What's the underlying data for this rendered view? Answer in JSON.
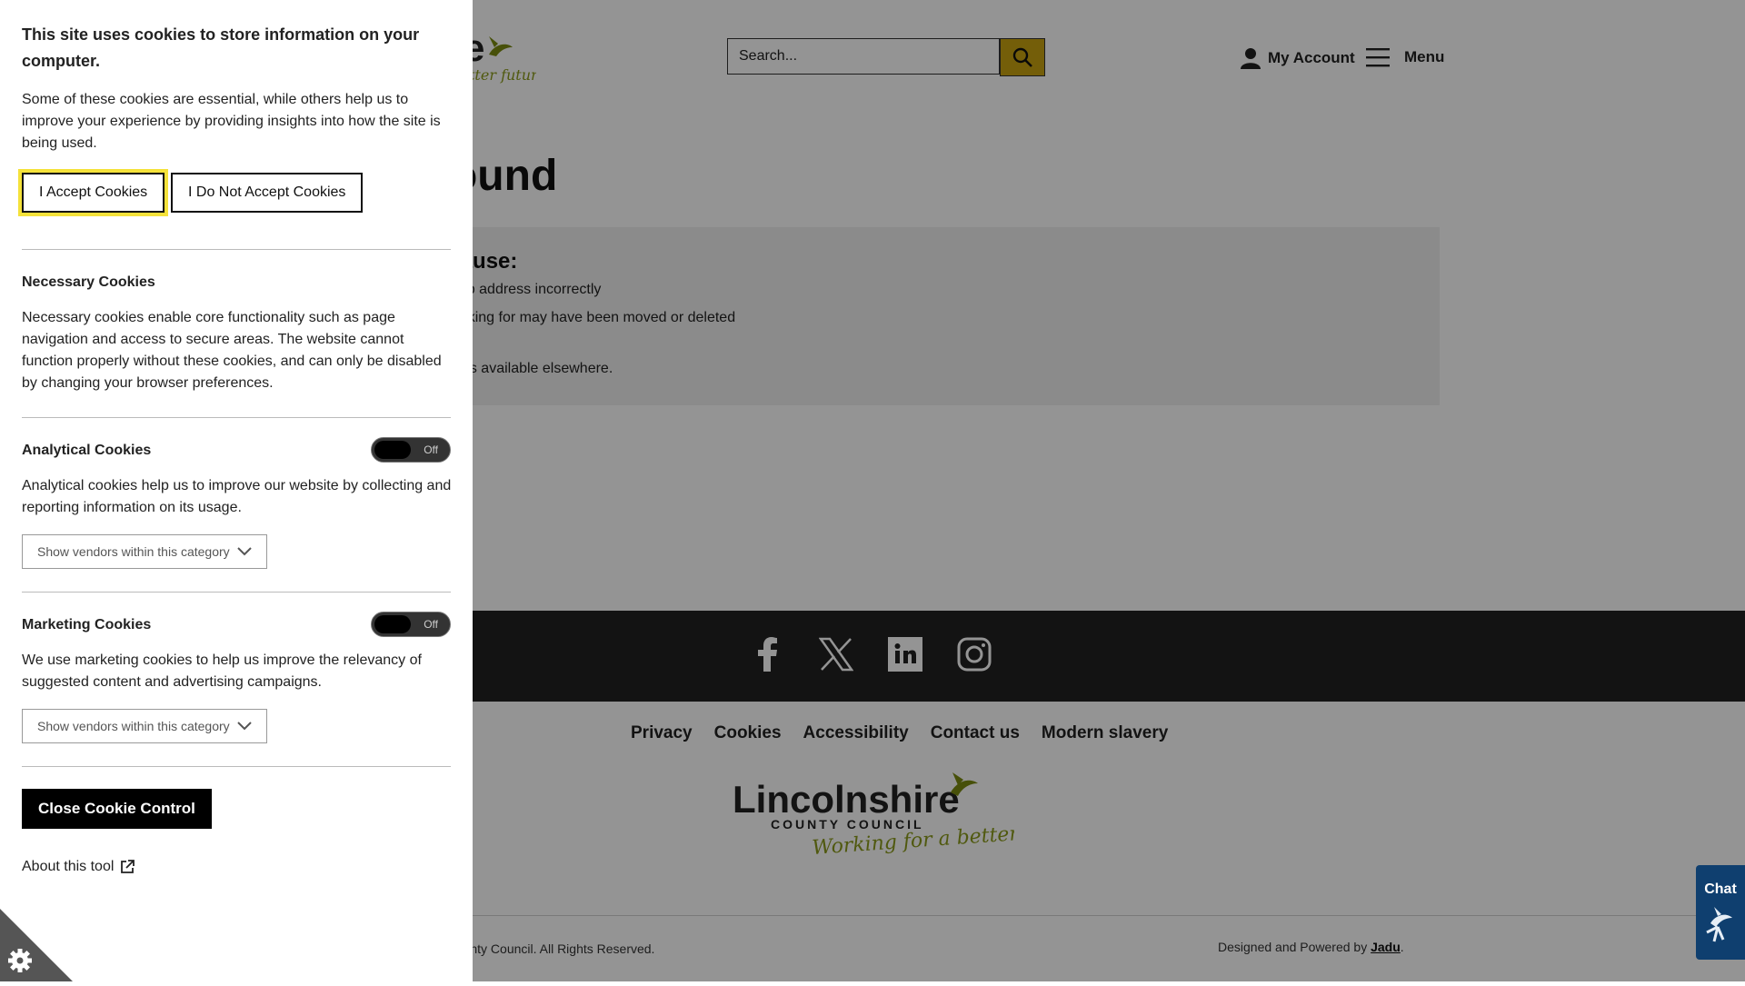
{
  "header": {
    "search_placeholder": "Search...",
    "account_label": "My Account",
    "menu_label": "Menu"
  },
  "main": {
    "title_visible": "found",
    "reasons_heading_visible": "ecause:",
    "reason_1_visible": "e web address incorrectly",
    "reason_2_visible": "e looking for may have been moved or deleted",
    "reason_3_visible": "e if it's available elsewhere."
  },
  "social": [
    "facebook-icon",
    "x-icon",
    "linkedin-icon",
    "instagram-icon"
  ],
  "footer": {
    "links": [
      "Privacy",
      "Cookies",
      "Accessibility",
      "Contact us",
      "Modern slavery"
    ],
    "logo_name": "Lincolnshire",
    "logo_sub": "COUNTY COUNCIL",
    "logo_tagline": "Working for a better future",
    "copyright_visible": "e County Council. All Rights Reserved.",
    "powered_prefix": "Designed and Powered by ",
    "powered_link": "Jadu",
    "powered_suffix": "."
  },
  "chat": {
    "label": "Chat"
  },
  "cookie_panel": {
    "heading": "This site uses cookies to store information on your computer.",
    "intro": "Some of these cookies are essential, while others help us to improve your experience by providing insights into how the site is being used.",
    "accept_label": "I Accept Cookies",
    "decline_label": "I Do Not Accept Cookies",
    "necessary_title": "Necessary Cookies",
    "necessary_text": "Necessary cookies enable core functionality such as page navigation and access to secure areas. The website cannot function properly without these cookies, and can only be disabled by changing your browser preferences.",
    "analytical_title": "Analytical Cookies",
    "analytical_toggle": "Off",
    "analytical_text": "Analytical cookies help us to improve our website by collecting and reporting information on its usage.",
    "vendors_label": "Show vendors within this category",
    "marketing_title": "Marketing Cookies",
    "marketing_toggle": "Off",
    "marketing_text": "We use marketing cookies to help us improve the relevancy of suggested content and advertising campaigns.",
    "close_label": "Close Cookie Control",
    "about_label": "About this tool"
  },
  "colors": {
    "accent_yellow": "#c8a310",
    "brand_green": "#8a9a1a",
    "chat_blue": "#0f3f6f",
    "footer_dark": "#222222"
  }
}
